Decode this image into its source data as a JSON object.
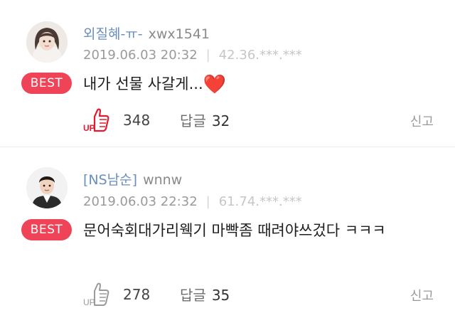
{
  "comments": [
    {
      "nickname": "외질혜-ㅠ-",
      "user_id": "xwx1541",
      "datetime": "2019.06.03 20:32",
      "separator": "|",
      "ip": "42.36.***.***",
      "badge": "BEST",
      "text": "내가 선물 사갈게...",
      "emoji": "❤️",
      "upvotes": "348",
      "reply_label": "답글",
      "reply_count": "32",
      "report_label": "신고",
      "upvote_active": true,
      "avatar_icon": "user-avatar-female"
    },
    {
      "nickname": "[NS남순]",
      "user_id": "wnnw",
      "datetime": "2019.06.03 22:32",
      "separator": "|",
      "ip": "61.74.***.***",
      "badge": "BEST",
      "text": "문어숙회대가리웩기 마빡좀 때려야쓰겄다 ㅋㅋㅋ",
      "upvotes": "278",
      "reply_label": "답글",
      "reply_count": "35",
      "report_label": "신고",
      "upvote_active": false,
      "avatar_icon": "user-avatar-male"
    }
  ],
  "colors": {
    "best_badge": "#ef4457",
    "nickname": "#6a8fbf",
    "upvote_active": "#e8182e",
    "upvote_inactive": "#9a9a9a"
  }
}
